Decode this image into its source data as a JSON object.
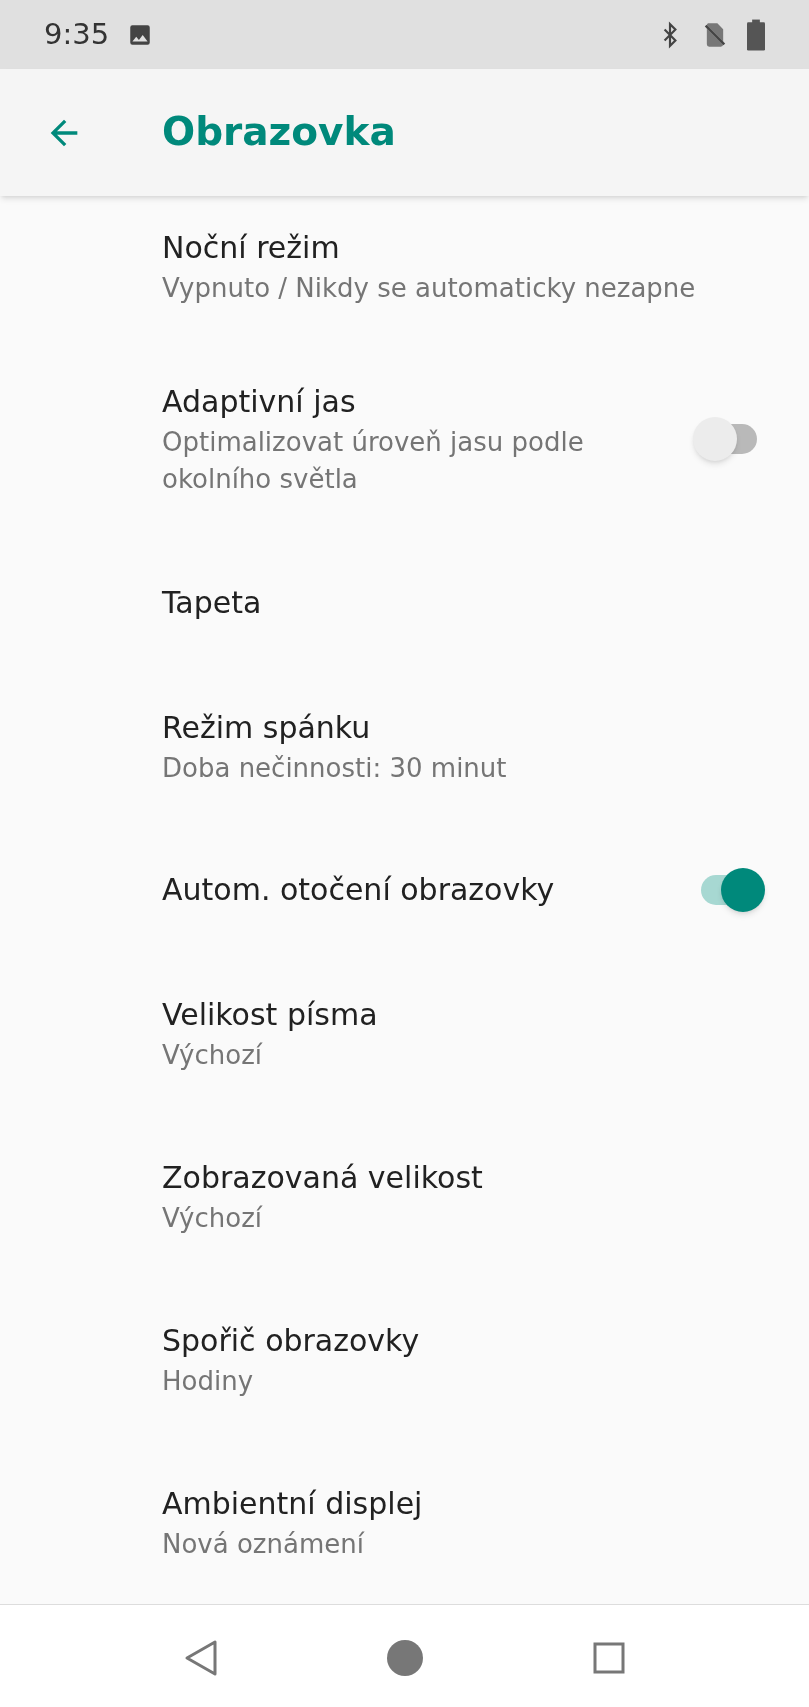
{
  "status_bar": {
    "time": "9:35"
  },
  "app_bar": {
    "title": "Obrazovka"
  },
  "settings": [
    {
      "kind": "plain",
      "title": "Noční režim",
      "subtitle": "Vypnuto / Nikdy se automaticky nezapne"
    },
    {
      "kind": "toggle",
      "title": "Adaptivní jas",
      "subtitle": "Optimalizovat úroveň jasu podle okolního světla",
      "on": false
    },
    {
      "kind": "plain",
      "title": "Tapeta"
    },
    {
      "kind": "plain",
      "title": "Režim spánku",
      "subtitle": "Doba nečinnosti: 30 minut"
    },
    {
      "kind": "toggle",
      "title": "Autom. otočení obrazovky",
      "on": true
    },
    {
      "kind": "plain",
      "title": "Velikost písma",
      "subtitle": "Výchozí"
    },
    {
      "kind": "plain",
      "title": "Zobrazovaná velikost",
      "subtitle": "Výchozí"
    },
    {
      "kind": "plain",
      "title": "Spořič obrazovky",
      "subtitle": "Hodiny"
    },
    {
      "kind": "plain",
      "title": "Ambientní displej",
      "subtitle": "Nová oznámení"
    }
  ]
}
